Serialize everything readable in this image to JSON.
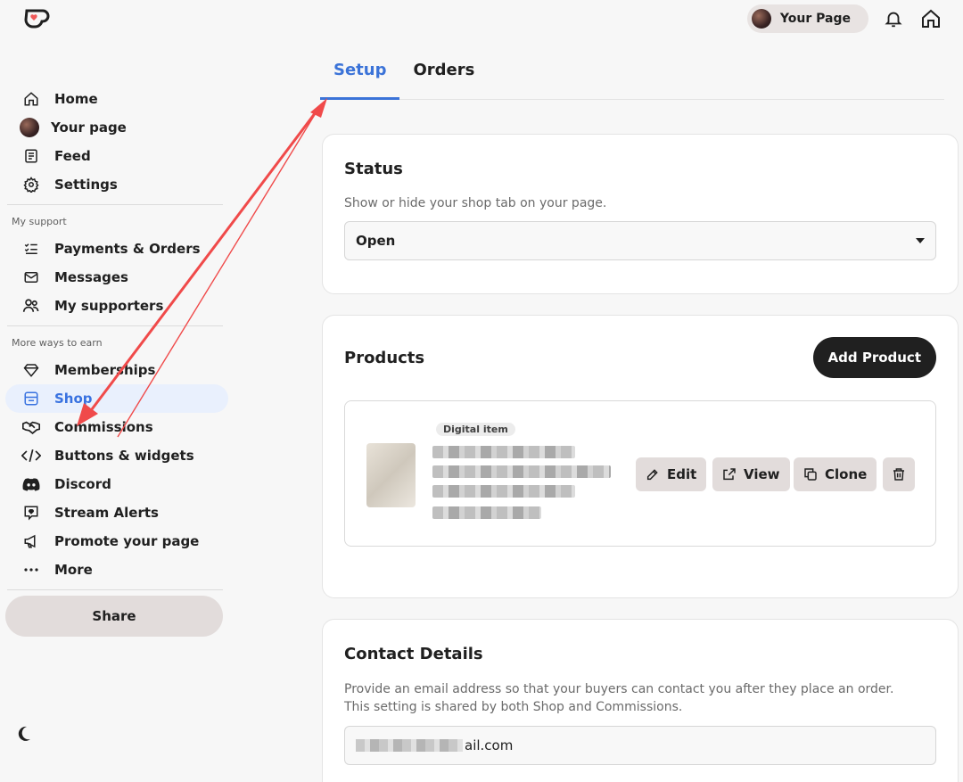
{
  "header": {
    "your_page_label": "Your Page"
  },
  "sidebar": {
    "items_main": [
      {
        "label": "Home",
        "icon": "home-icon"
      },
      {
        "label": "Your page",
        "icon": "avatar"
      },
      {
        "label": "Feed",
        "icon": "feed-icon"
      },
      {
        "label": "Settings",
        "icon": "gear-icon"
      }
    ],
    "section_support": "My support",
    "items_support": [
      {
        "label": "Payments & Orders",
        "icon": "list-check-icon"
      },
      {
        "label": "Messages",
        "icon": "mail-icon"
      },
      {
        "label": "My supporters",
        "icon": "users-icon"
      }
    ],
    "section_earn": "More ways to earn",
    "items_earn": [
      {
        "label": "Memberships",
        "icon": "diamond-icon"
      },
      {
        "label": "Shop",
        "icon": "shop-icon",
        "active": true
      },
      {
        "label": "Commissions",
        "icon": "handshake-icon"
      },
      {
        "label": "Buttons & widgets",
        "icon": "code-icon"
      },
      {
        "label": "Discord",
        "icon": "discord-icon"
      },
      {
        "label": "Stream Alerts",
        "icon": "stream-alert-icon"
      },
      {
        "label": "Promote your page",
        "icon": "megaphone-icon"
      },
      {
        "label": "More",
        "icon": "more-icon"
      }
    ],
    "share_label": "Share"
  },
  "tabs": [
    {
      "label": "Setup",
      "active": true
    },
    {
      "label": "Orders",
      "active": false
    }
  ],
  "status_card": {
    "title": "Status",
    "description": "Show or hide your shop tab on your page.",
    "selected": "Open"
  },
  "products_card": {
    "title": "Products",
    "add_label": "Add Product",
    "product": {
      "badge": "Digital item",
      "edit_label": "Edit",
      "view_label": "View",
      "clone_label": "Clone"
    }
  },
  "contact_card": {
    "title": "Contact Details",
    "description": "Provide an email address so that your buyers can contact you after they place an order. This setting is shared by both Shop and Commissions.",
    "email_suffix": "ail.com"
  },
  "colors": {
    "accent": "#3b73d8",
    "active_bg": "#e9f0fd",
    "annotation": "#f04a4a"
  }
}
